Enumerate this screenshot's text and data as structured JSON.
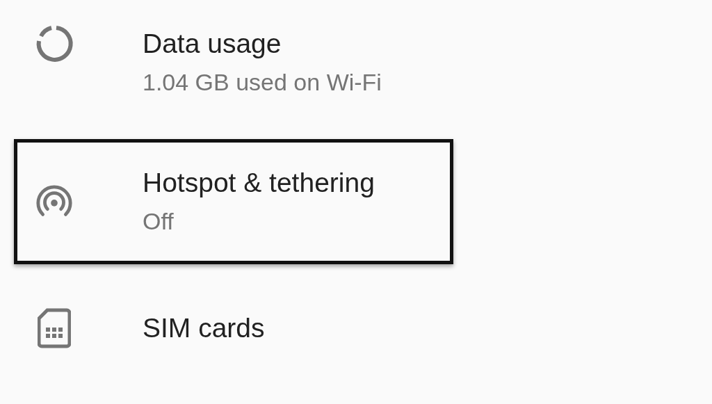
{
  "items": [
    {
      "kind": "data",
      "title": "Data usage",
      "subtitle": "1.04 GB used on Wi-Fi",
      "highlighted": false
    },
    {
      "kind": "hotspot",
      "title": "Hotspot & tethering",
      "subtitle": "Off",
      "highlighted": true
    },
    {
      "kind": "sim",
      "title": "SIM cards",
      "highlighted": false
    }
  ]
}
